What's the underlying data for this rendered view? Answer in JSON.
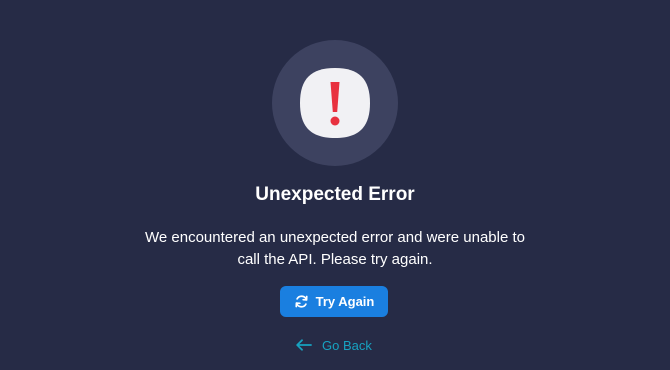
{
  "error": {
    "icon": "exclamation-icon",
    "title": "Unexpected Error",
    "message": "We encountered an unexpected error and were unable to call the API. Please try again."
  },
  "actions": {
    "retry_label": "Try Again",
    "retry_icon": "refresh-icon",
    "back_label": "Go Back",
    "back_icon": "arrow-left-icon"
  },
  "colors": {
    "background": "#262b46",
    "icon_circle": "#3d4260",
    "danger": "#e8313f",
    "primary": "#1a7fe0",
    "link": "#17a2c0"
  }
}
